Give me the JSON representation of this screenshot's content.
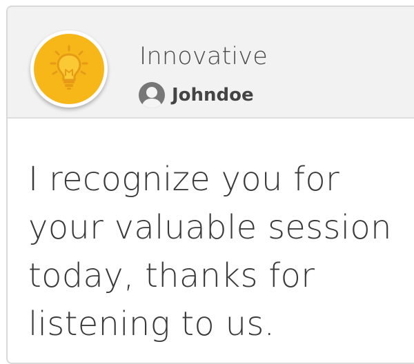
{
  "card": {
    "badge_icon": "lightbulb-icon",
    "badge_color": "#f7b718",
    "title": "Innovative",
    "author": {
      "avatar_icon": "user-avatar-icon",
      "name": "Johndoe"
    },
    "message": "I recognize you for your valuable session today, thanks for listening to us."
  }
}
